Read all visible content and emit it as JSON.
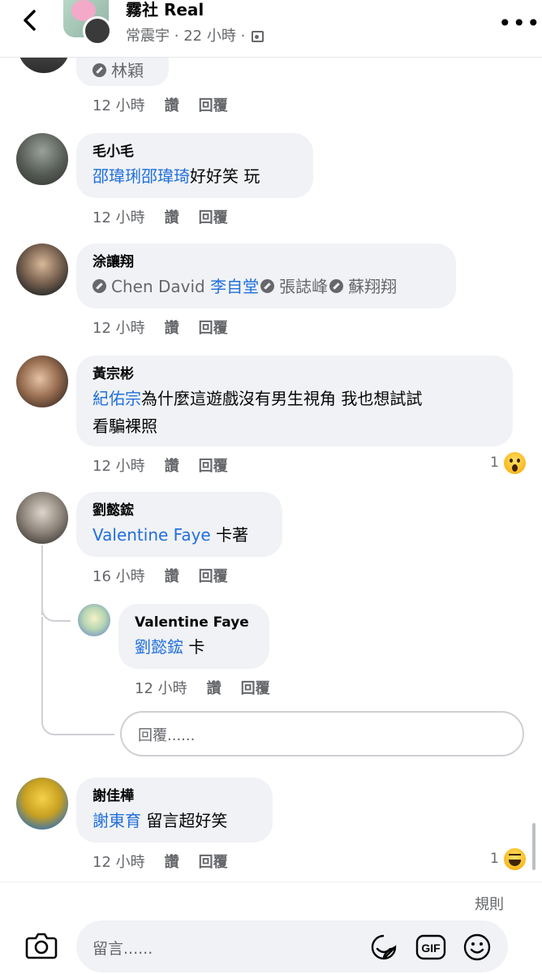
{
  "header": {
    "title": "霧社 Real",
    "author": "常震宇",
    "time": "22 小時",
    "separator": "·"
  },
  "labels": {
    "like": "讚",
    "reply": "回覆"
  },
  "comments": [
    {
      "name": "",
      "text_tag": "林穎",
      "time": "12 小時"
    },
    {
      "name": "毛小毛",
      "text_tag": "邵瑋琍邵瑋琦",
      "text_rest": "好好笑 玩",
      "time": "12 小時"
    },
    {
      "name": "涂讓翔",
      "tag1": "Chen David",
      "tag2": "李自堂",
      "tag3": "張誌峰",
      "tag4": "蘇翔翔",
      "time": "12 小時"
    },
    {
      "name": "黃宗彬",
      "text_tag": "紀佑宗",
      "text_line1_rest": "為什麼這遊戲沒有男生視角 我也想試試",
      "text_line2": "看騙裸照",
      "time": "12 小時",
      "reaction_count": "1"
    },
    {
      "name": "劉懿鋐",
      "text_tag": "Valentine Faye",
      "text_rest": " 卡著",
      "time": "16 小時"
    },
    {
      "name": "Valentine Faye",
      "text_tag": "劉懿鋐",
      "text_rest": " 卡",
      "time": "12 小時"
    },
    {
      "name": "謝佳樺",
      "text_tag": "謝東育",
      "text_rest": " 留言超好笑",
      "time": "12 小時",
      "reaction_count": "1"
    }
  ],
  "reply_placeholder": "回覆......",
  "rules_label": "規則",
  "comment_placeholder": "留言......",
  "icons": [
    "back-arrow-icon",
    "more-icon",
    "camera-icon",
    "sticker-icon",
    "gif-icon",
    "emoji-icon",
    "wow-reaction-icon",
    "haha-reaction-icon"
  ],
  "colors": {
    "tag": "#216fdb",
    "bubble": "#f0f2f5",
    "meta": "#65676b"
  }
}
